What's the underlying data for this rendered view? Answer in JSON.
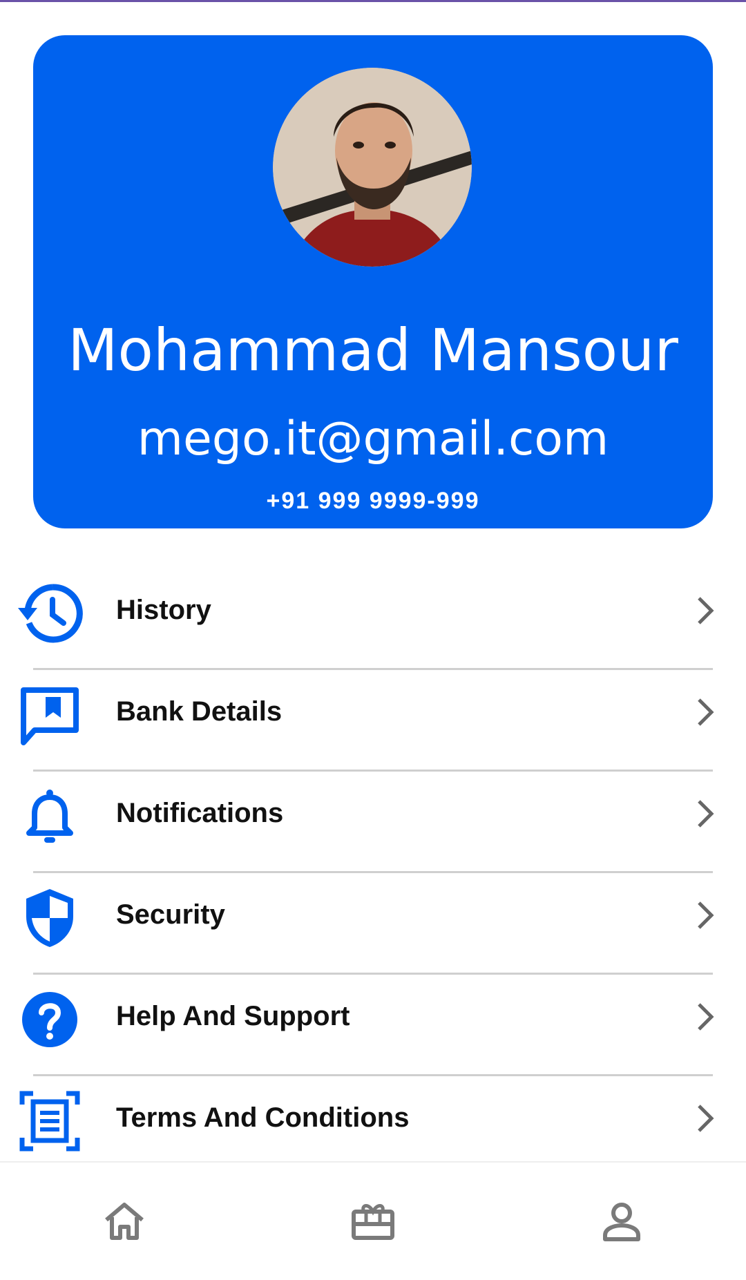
{
  "profile": {
    "name": "Mohammad Mansour",
    "email": "mego.it@gmail.com",
    "phone": "+91 999 9999-999",
    "avatar_icon": "user-photo"
  },
  "menu": {
    "items": [
      {
        "label": "History",
        "icon": "history-icon"
      },
      {
        "label": "Bank Details",
        "icon": "bookmark-message-icon"
      },
      {
        "label": "Notifications",
        "icon": "bell-icon"
      },
      {
        "label": "Security",
        "icon": "shield-icon"
      },
      {
        "label": "Help And Support",
        "icon": "help-circle-icon"
      },
      {
        "label": "Terms And Conditions",
        "icon": "document-scan-icon"
      }
    ]
  },
  "bottom_nav": {
    "items": [
      {
        "icon": "home-icon"
      },
      {
        "icon": "gift-card-icon"
      },
      {
        "icon": "profile-icon"
      }
    ]
  },
  "colors": {
    "accent": "#0062ee",
    "chevron": "#666666",
    "nav_icon": "#7a7a7a"
  }
}
